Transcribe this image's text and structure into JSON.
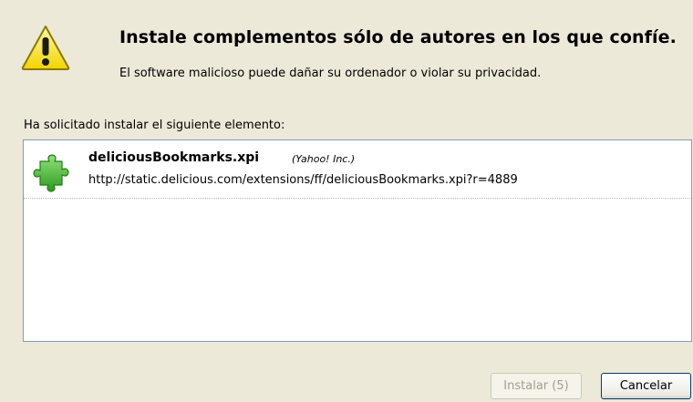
{
  "dialog": {
    "headline": "Instale complementos sólo de autores en los que confíe.",
    "subline": "El software malicioso puede dañar su ordenador o violar su privacidad.",
    "warning_icon": "warning-icon",
    "warning_color": "#F5E600"
  },
  "list": {
    "label": "Ha solicitado instalar el siguiente elemento:",
    "items": [
      {
        "name": "deliciousBookmarks.xpi",
        "author": "(Yahoo! Inc.)",
        "url": "http://static.delicious.com/extensions/ff/deliciousBookmarks.xpi?r=4889",
        "icon": "puzzle-piece-icon",
        "icon_color": "#3FAE2A"
      }
    ]
  },
  "buttons": {
    "install_label": "Instalar (5)",
    "cancel_label": "Cancelar"
  }
}
